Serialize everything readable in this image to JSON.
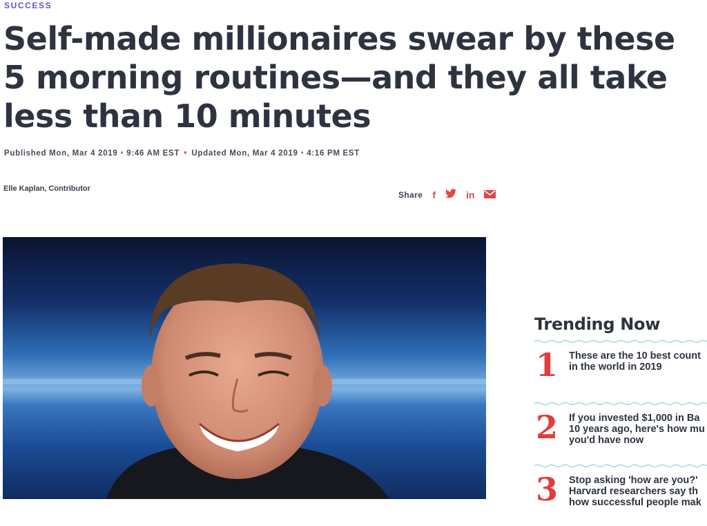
{
  "article": {
    "kicker": "SUCCESS",
    "headline": "Self-made millionaires swear by these 5 morning routines—and they all take less than 10 minutes",
    "published": "Published Mon, Mar 4 2019",
    "published_time": "9:46 AM EST",
    "updated": "Updated Mon, Mar 4 2019",
    "updated_time": "4:16 PM EST",
    "byline": "Elle Kaplan, Contributor"
  },
  "share": {
    "label": "Share",
    "icons": [
      "facebook-icon",
      "twitter-icon",
      "linkedin-icon",
      "email-icon"
    ],
    "facebook_glyph": "f",
    "linkedin_glyph": "in"
  },
  "trending": {
    "title": "Trending Now",
    "items": [
      {
        "rank": "1",
        "text": "These are the 10 best count\nin the world in 2019"
      },
      {
        "rank": "2",
        "text": "If you invested $1,000 in Ba\n10 years ago, here's how mu\nyou'd have now"
      },
      {
        "rank": "3",
        "text": "Stop asking 'how are you?'\nHarvard researchers say th\nhow successful people mak"
      }
    ]
  },
  "colors": {
    "kicker": "#6b4fc9",
    "accent_red": "#e04646",
    "heading": "#2e3340",
    "wave": "#8fd3d8"
  }
}
